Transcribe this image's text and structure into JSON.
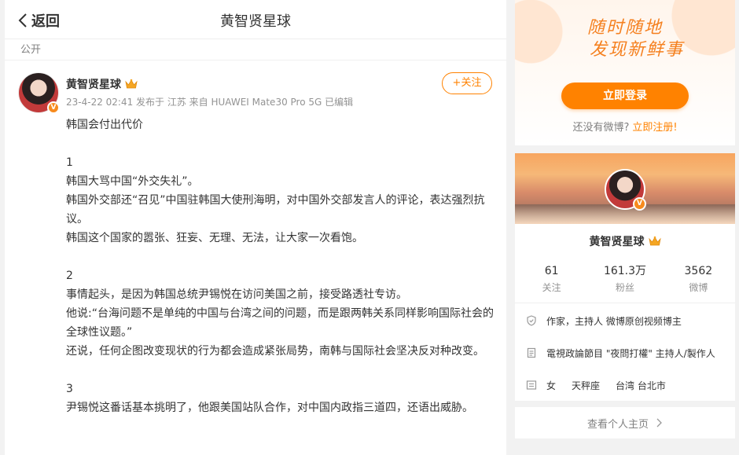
{
  "header": {
    "back_label": "返回",
    "title": "黄智贤星球"
  },
  "post": {
    "visibility": "公开",
    "author": "黄智贤星球",
    "meta": "23-4-22 02:41 发布于 江苏 来自 HUAWEI Mate30 Pro 5G 已编辑",
    "follow_label": "+关注",
    "paragraphs": [
      "韩国会付出代价",
      "",
      "1",
      "韩国大骂中国“外交失礼”。",
      "韩国外交部还“召见”中国驻韩国大使刑海明，对中国外交部发言人的评论，表达强烈抗议。",
      "韩国这个国家的嚣张、狂妄、无理、无法，让大家一次看饱。",
      "",
      "2",
      "事情起头，是因为韩国总统尹锡悦在访问美国之前，接受路透社专访。",
      "他说:“台海问题不是单纯的中国与台湾之间的问题，而是跟两韩关系同样影响国际社会的全球性议题。”",
      "还说，任何企图改变现状的行为都会造成紧张局势，南韩与国际社会坚决反对种改变。",
      "",
      "3",
      "尹锡悦这番话基本挑明了，他跟美国站队合作，对中国内政指三道四，还语出威胁。"
    ]
  },
  "login_card": {
    "slogan_line1": "随时随地",
    "slogan_line2": "发现新鲜事",
    "login_label": "立即登录",
    "no_account_text": "还没有微博?",
    "register_label": "立即注册!"
  },
  "profile": {
    "name": "黄智贤星球",
    "stats": [
      {
        "num": "61",
        "label": "关注"
      },
      {
        "num": "161.3万",
        "label": "粉丝"
      },
      {
        "num": "3562",
        "label": "微博"
      }
    ],
    "verification": "作家，主持人 微博原创视频博主",
    "description": "電視政論節目 \"夜問打權\" 主持人/製作人",
    "gender": "女",
    "zodiac": "天秤座",
    "location": "台湾 台北市",
    "homepage_label": "查看个人主页"
  },
  "colors": {
    "accent": "#ff8200",
    "badge": "#f78b1e",
    "page_bg": "#f2f2f2"
  }
}
